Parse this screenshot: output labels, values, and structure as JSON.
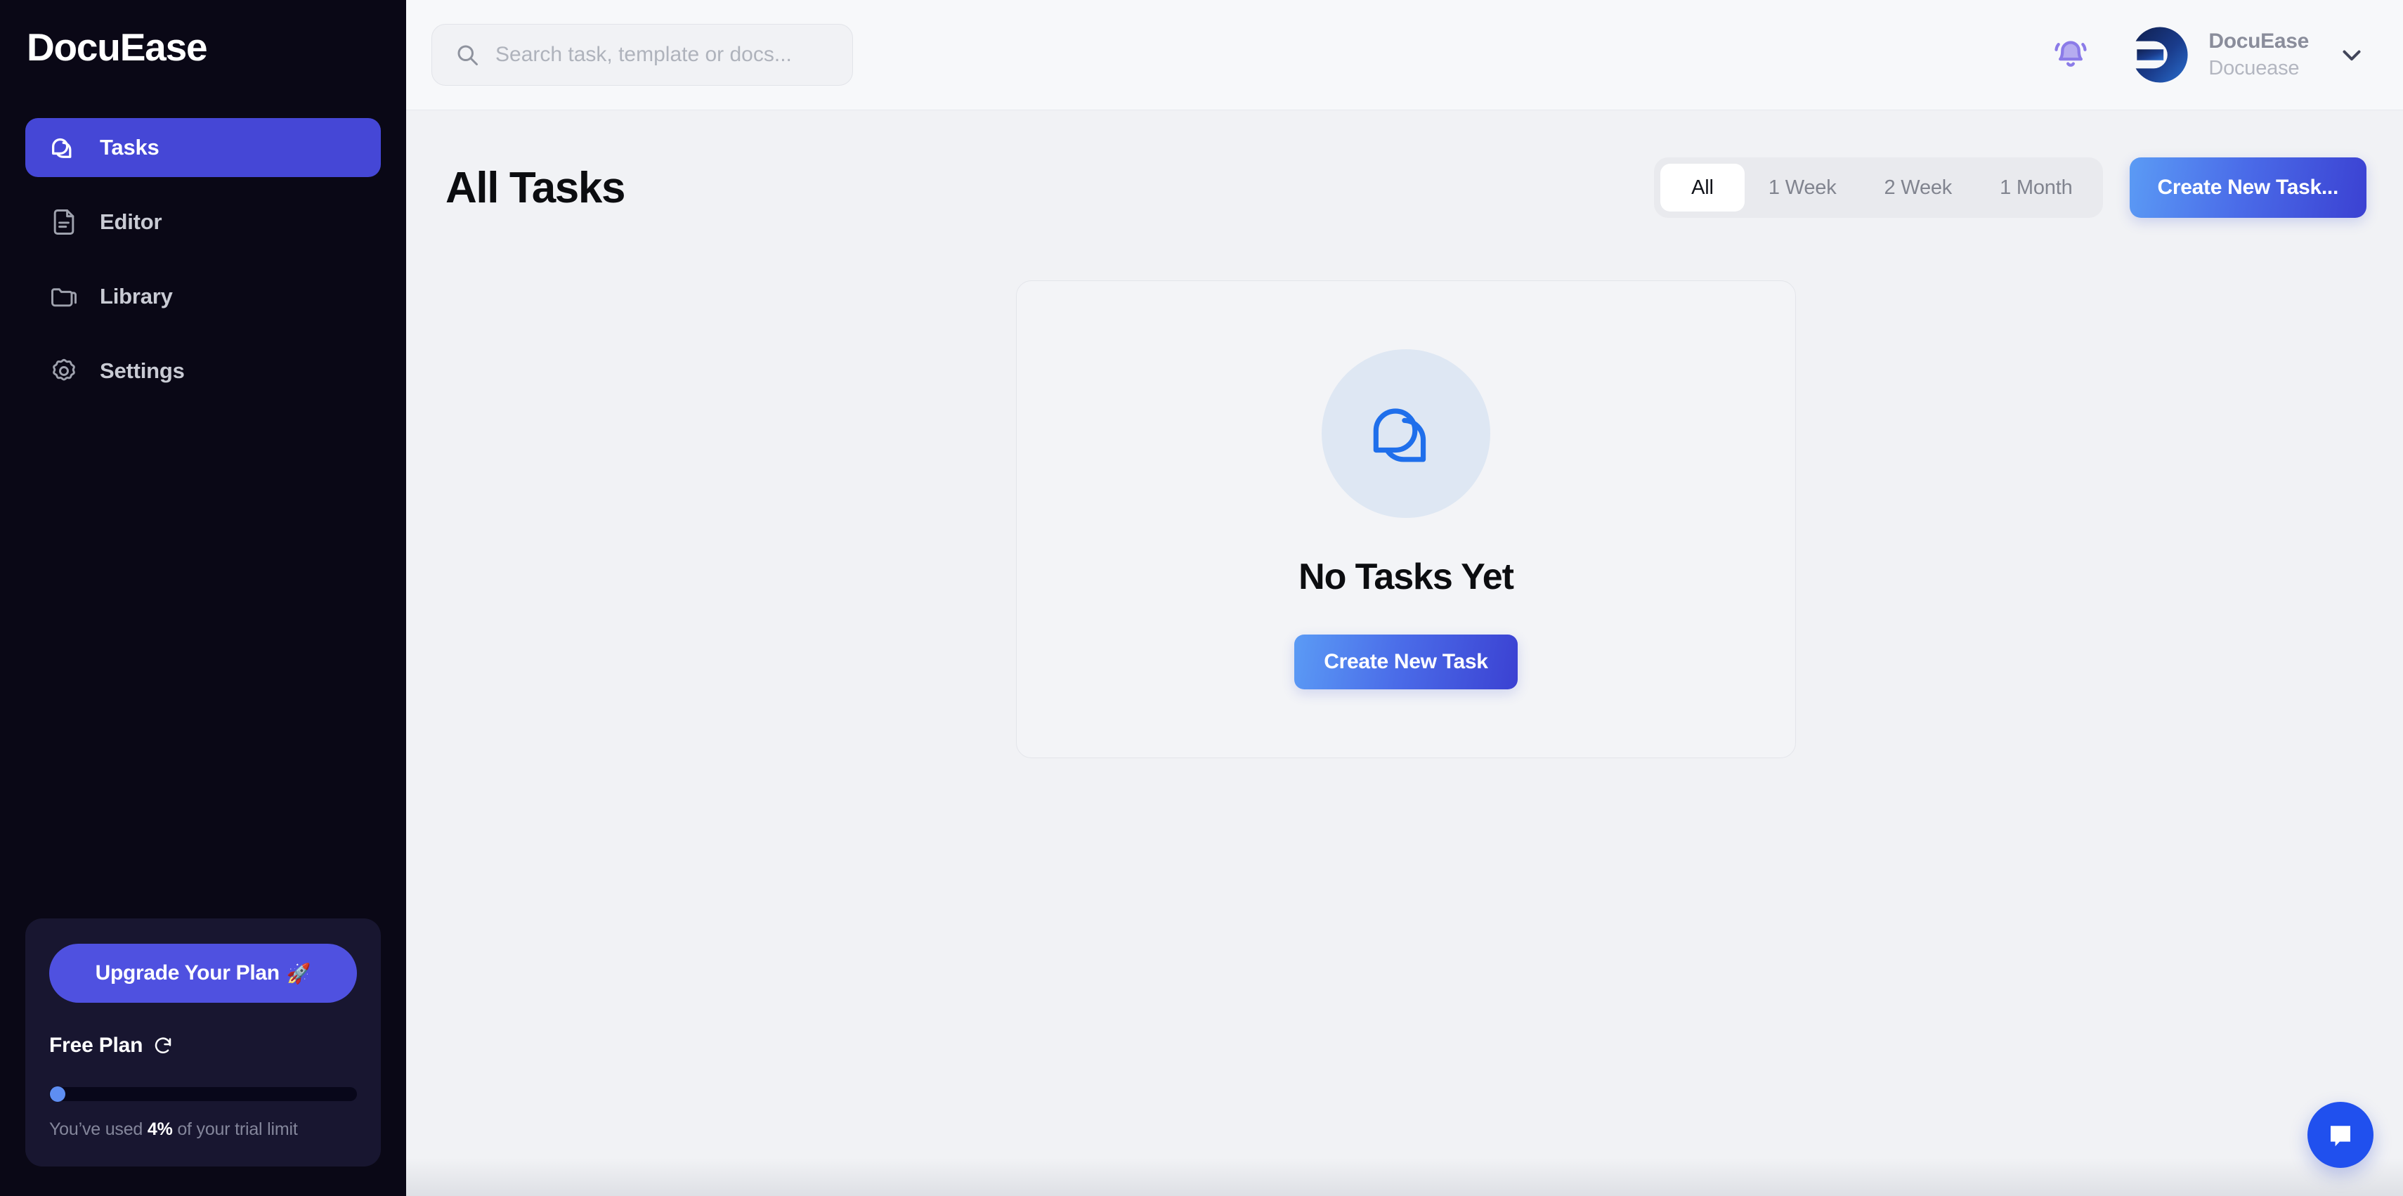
{
  "brand": {
    "name": "DocuEase"
  },
  "sidebar": {
    "items": [
      {
        "label": "Tasks",
        "icon": "chat-bubbles-icon",
        "active": true
      },
      {
        "label": "Editor",
        "icon": "document-icon",
        "active": false
      },
      {
        "label": "Library",
        "icon": "folder-icon",
        "active": false
      },
      {
        "label": "Settings",
        "icon": "gear-icon",
        "active": false
      }
    ],
    "upgrade": {
      "button_label": "Upgrade Your Plan",
      "button_emoji": "🚀",
      "plan_name": "Free Plan",
      "refresh_icon": "refresh-icon",
      "progress_percent": 4,
      "usage_prefix": "You’ve used ",
      "usage_value": "4%",
      "usage_suffix": " of your trial limit"
    }
  },
  "topbar": {
    "search": {
      "placeholder": "Search task, template or docs...",
      "value": "",
      "icon": "search-icon"
    },
    "notifications_icon": "bell-icon",
    "user": {
      "name": "DocuEase",
      "org": "Docuease",
      "avatar_icon": "docuease-logo-icon",
      "chevron_icon": "chevron-down-icon"
    }
  },
  "page": {
    "title": "All Tasks",
    "filters": [
      {
        "label": "All",
        "active": true
      },
      {
        "label": "1 Week",
        "active": false
      },
      {
        "label": "2 Week",
        "active": false
      },
      {
        "label": "1 Month",
        "active": false
      }
    ],
    "create_task_top_label": "Create New Task...",
    "empty_state": {
      "icon": "chat-bubbles-icon",
      "title": "No Tasks Yet",
      "cta_label": "Create New Task"
    }
  },
  "chat_widget": {
    "icon": "chat-message-icon"
  },
  "colors": {
    "sidebar_bg": "#0A0816",
    "accent_indigo": "#4547D6",
    "accent_blue": "#2050EE",
    "cta_gradient_from": "#5B9BF5",
    "cta_gradient_to": "#3B41D2",
    "main_bg": "#F1F2F5",
    "bell_purple": "#8B7BE8"
  }
}
